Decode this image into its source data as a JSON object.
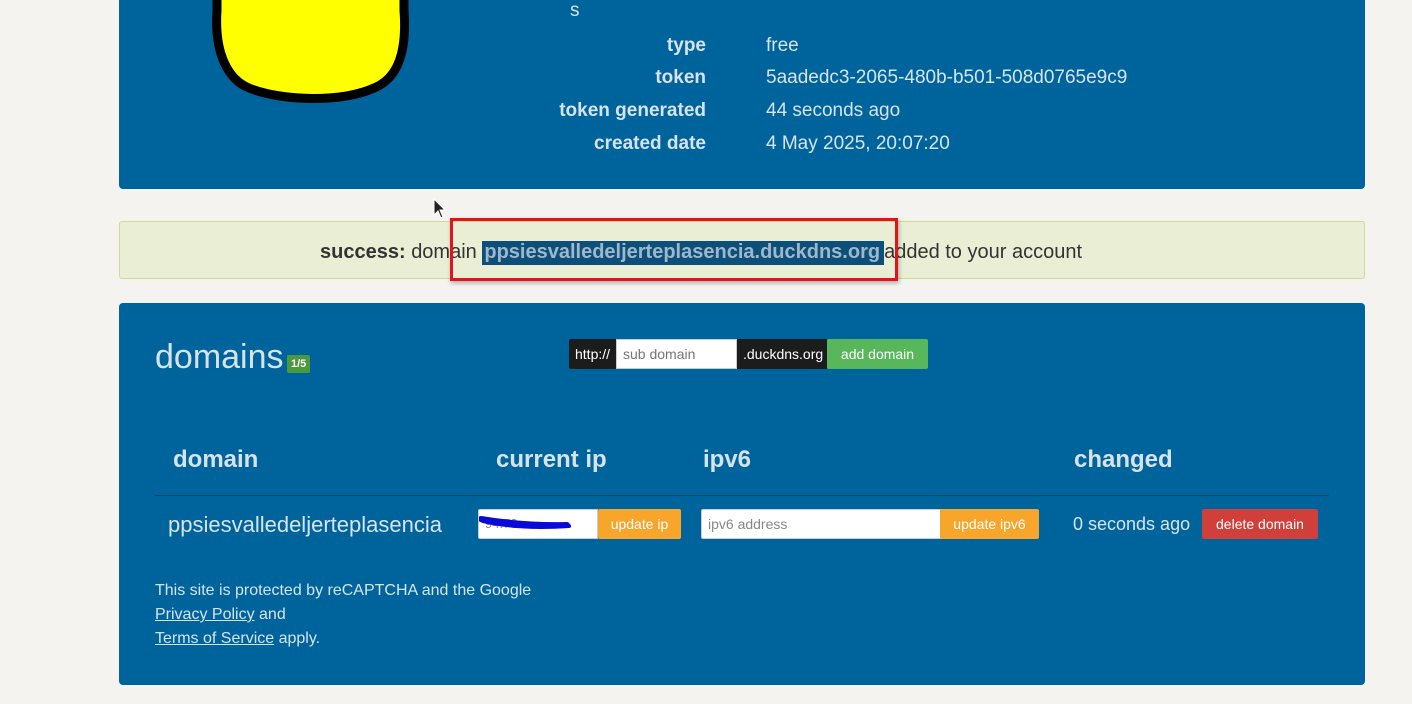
{
  "account": {
    "trailing_text": "s",
    "rows": [
      {
        "key": "type",
        "value": "free"
      },
      {
        "key": "token",
        "value": "5aadedc3-2065-480b-b501-508d0765e9c9"
      },
      {
        "key": "token generated",
        "value": "44 seconds ago"
      },
      {
        "key": "created date",
        "value": "4 May 2025, 20:07:20"
      }
    ]
  },
  "alert": {
    "label": "success:",
    "prefix": "domain",
    "domain": "ppsiesvalledeljerteplasencia.duckdns.org",
    "suffix": "added to your account"
  },
  "domains": {
    "title": "domains",
    "badge": "1/5",
    "protocol_prefix": "http://",
    "subdomain_placeholder": "sub domain",
    "suffix": ".duckdns.org",
    "add_button": "add domain",
    "columns": [
      "domain",
      "current ip",
      "ipv6",
      "changed"
    ],
    "row": {
      "domain": "ppsiesvalledeljerteplasencia",
      "ip_value": "94.73.",
      "update_ip_button": "update ip",
      "ipv6_placeholder": "ipv6 address",
      "update_ipv6_button": "update ipv6",
      "changed": "0 seconds ago",
      "delete_button": "delete domain"
    }
  },
  "footer": {
    "line1": "This site is protected by reCAPTCHA and the Google",
    "privacy": "Privacy Policy",
    "and": "and",
    "terms": "Terms of Service",
    "apply": "apply."
  },
  "colors": {
    "panel": "#00649c",
    "alert_bg": "#e9eed4",
    "highlight_box": "#e0141a",
    "add_button": "#58b65b",
    "update_button": "#f7a52b",
    "delete_button": "#d03f3a"
  }
}
